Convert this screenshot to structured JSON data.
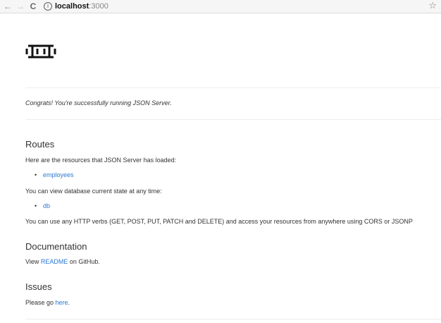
{
  "browser": {
    "back_icon": "←",
    "forward_icon": "→",
    "reload_icon": "C",
    "info_icon": "i",
    "url_host": "localhost",
    "url_port": ":3000",
    "bookmark_icon": "☆"
  },
  "logo_text": "ⵎ",
  "congrats": "Congrats! You're successfully running JSON Server.",
  "routes": {
    "heading": "Routes",
    "intro": "Here are the resources that JSON Server has loaded:",
    "resources": [
      {
        "label": "employees"
      }
    ],
    "db_intro": "You can view database current state at any time:",
    "db_link": "db",
    "verbs_text": "You can use any HTTP verbs (GET, POST, PUT, PATCH and DELETE) and access your resources from anywhere using CORS or JSONP"
  },
  "documentation": {
    "heading": "Documentation",
    "pre": "View ",
    "link": "README",
    "post": " on GitHub."
  },
  "issues": {
    "heading": "Issues",
    "pre": "Please go ",
    "link": "here",
    "post": "."
  },
  "colors": {
    "link": "#2a7ad1",
    "text": "#333333",
    "divider": "#eeeeee"
  }
}
